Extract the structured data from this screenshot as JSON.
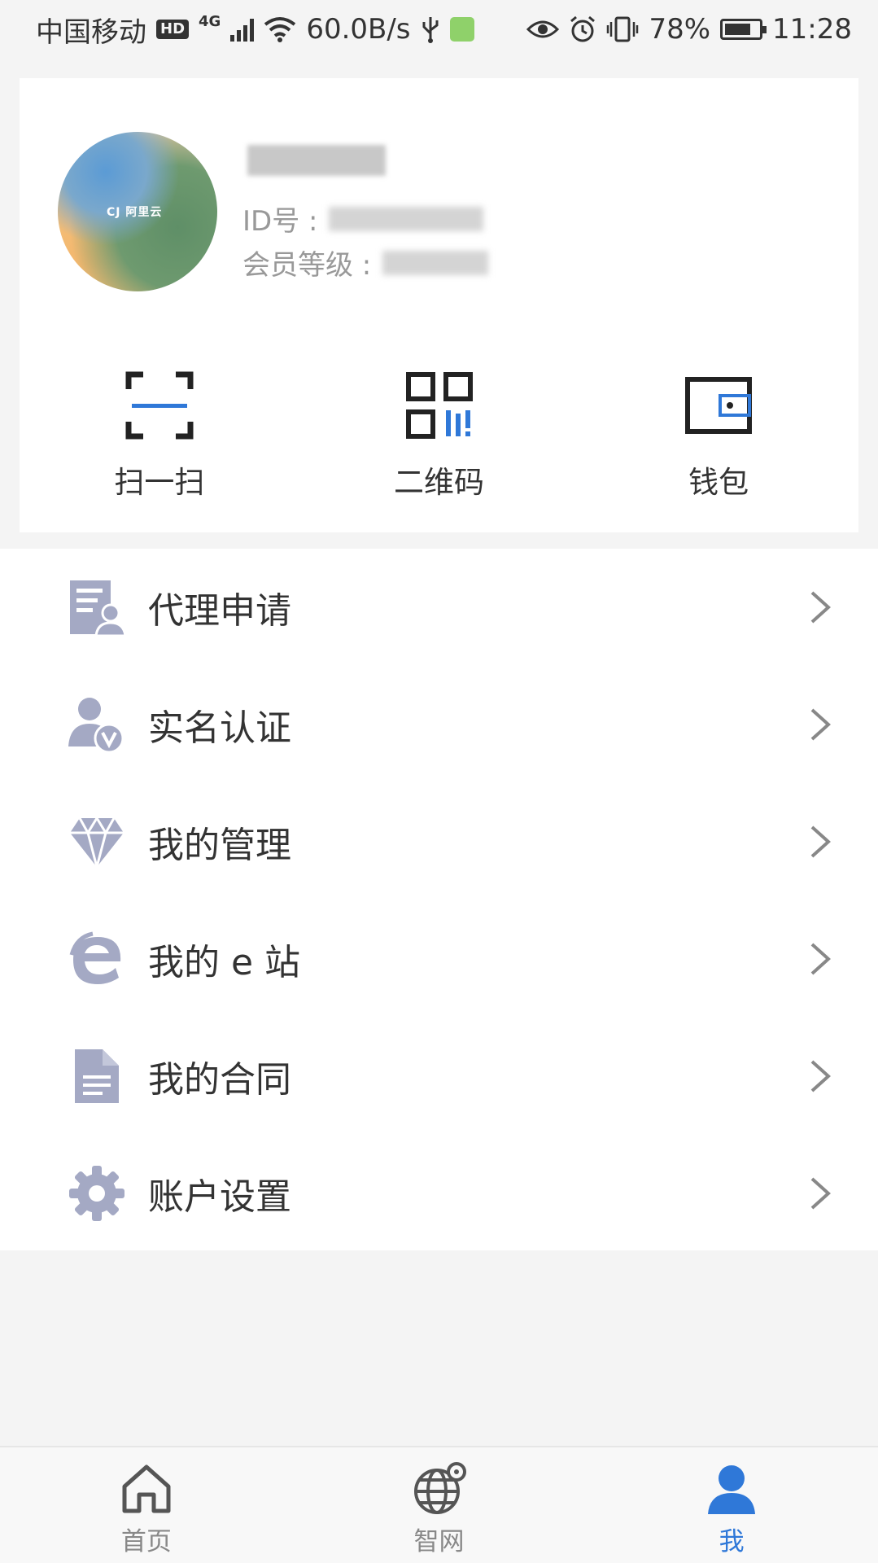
{
  "status_bar": {
    "carrier": "中国移动",
    "hd": "HD",
    "network": "4G",
    "speed": "60.0B/s",
    "battery": "78%",
    "battery_level": 0.78,
    "time": "11:28"
  },
  "profile": {
    "avatar_logo_text": "CJ 阿里云",
    "id_label": "ID号 :",
    "level_label": "会员等级 :"
  },
  "quick_actions": [
    {
      "label": "扫一扫",
      "icon": "scan-icon"
    },
    {
      "label": "二维码",
      "icon": "qrcode-icon"
    },
    {
      "label": "钱包",
      "icon": "wallet-icon"
    }
  ],
  "menu": [
    {
      "label": "代理申请",
      "icon": "agent-application-icon"
    },
    {
      "label": "实名认证",
      "icon": "verified-user-icon"
    },
    {
      "label": "我的管理",
      "icon": "diamond-icon"
    },
    {
      "label": "我的 e 站",
      "icon": "e-site-icon"
    },
    {
      "label": "我的合同",
      "icon": "contract-document-icon"
    },
    {
      "label": "账户设置",
      "icon": "gear-icon"
    }
  ],
  "tabs": [
    {
      "label": "首页",
      "icon": "home-icon",
      "active": false
    },
    {
      "label": "智网",
      "icon": "globe-icon",
      "active": false
    },
    {
      "label": "我",
      "icon": "person-icon",
      "active": true
    }
  ],
  "colors": {
    "accent": "#2f78d8",
    "icon_gray": "#a4a9c4",
    "background": "#f4f4f4"
  }
}
